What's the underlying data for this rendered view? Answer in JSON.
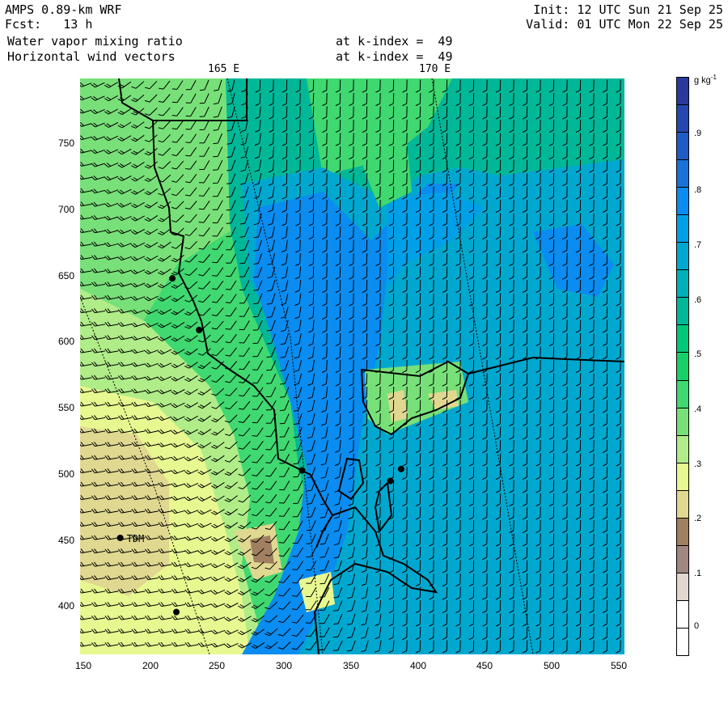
{
  "header": {
    "model": "AMPS 0.89-km WRF",
    "forecast": "Fcst:   13 h",
    "init": "Init: 12 UTC Sun 21 Sep 25",
    "valid": "Valid: 01 UTC Mon 22 Sep 25",
    "field1": "Water vapor mixing ratio",
    "field1_level": "at k-index =  49",
    "field2": "Horizontal wind vectors",
    "field2_level": "at k-index =  49"
  },
  "map": {
    "meridian_labels": [
      "165 E",
      "170 E"
    ],
    "x_ticks": [
      "150",
      "200",
      "250",
      "300",
      "350",
      "400",
      "450",
      "500",
      "550"
    ],
    "y_ticks": [
      "750",
      "700",
      "650",
      "600",
      "550",
      "500",
      "450",
      "400"
    ],
    "x_range": [
      148,
      555
    ],
    "y_range": [
      365,
      800
    ],
    "stations": [
      {
        "name": "TDM",
        "x": 178,
        "y": 453
      },
      {
        "name": "",
        "x": 217,
        "y": 649
      },
      {
        "name": "",
        "x": 237,
        "y": 610
      },
      {
        "name": "",
        "x": 314,
        "y": 504
      },
      {
        "name": "",
        "x": 380,
        "y": 496
      },
      {
        "name": "",
        "x": 388,
        "y": 505
      },
      {
        "name": "",
        "x": 220,
        "y": 397
      }
    ]
  },
  "colorbar": {
    "units": "g kg",
    "units_exp": "-1",
    "labels": [
      ".9",
      ".8",
      ".7",
      ".6",
      ".5",
      ".4",
      ".3",
      ".2",
      ".1",
      "0"
    ],
    "colors": [
      "#2b389c",
      "#2448b0",
      "#1f5cc4",
      "#1a72d8",
      "#0a8cf0",
      "#00a0e8",
      "#00a8d0",
      "#00b0b8",
      "#00b898",
      "#00c878",
      "#18d068",
      "#40d870",
      "#78e078",
      "#b0ec88",
      "#e8f890",
      "#e0d890",
      "#a08060",
      "#a08880",
      "#e0d8d0",
      "#ffffff",
      "#ffffff"
    ]
  }
}
